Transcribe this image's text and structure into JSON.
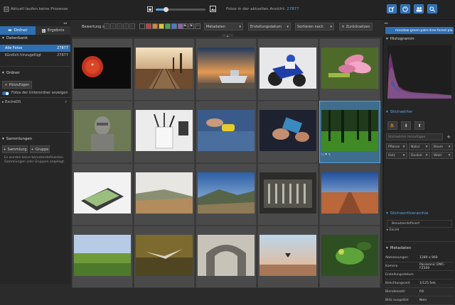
{
  "topbar": {
    "status": "Aktuell laufen keine Prozesse",
    "photos_label": "Fotos in der aktuellen Ansicht:",
    "photos_count": "27877",
    "zoom_fraction": 0.2
  },
  "filterbar": {
    "rating_label": "Bewertung",
    "rating_op": "≥",
    "metadata": "Metadaten",
    "date": "Erstellungsdatum",
    "sort": "Sortieren nach",
    "reset": "Zurücksetzen",
    "color_swatches": [
      "#c43c3c",
      "#d08a2e",
      "#d6c93a",
      "#4aa84a",
      "#3e7fd0",
      "#9a5ac8"
    ]
  },
  "sidebar": {
    "tab_folders": "Ordner",
    "tab_results": "Ergebnis",
    "db_title": "Datenbank",
    "db_items": [
      {
        "label": "Alle Fotos",
        "count": "27877"
      },
      {
        "label": "Kürzlich hinzugefügt",
        "count": "27877"
      }
    ],
    "folders_title": "Ordner",
    "add_button": "Hinzufügen",
    "subfolders_toggle": "Fotos der Unterordner anzeigen",
    "folder_item": "ExcireDS",
    "collections_title": "Sammlungen",
    "add_collection": "Sammlung",
    "add_group": "Gruppe",
    "empty_note": "Es wurden keine benutzerdefinierten Sammlungen oder Gruppen angelegt."
  },
  "right": {
    "filename": "meadow-green-palm-tree-forest-pla...",
    "histogram_title": "Histogramm",
    "keywords_title": "Stichwörter",
    "keyword_placeholder": "Stichwörter hinzufügen",
    "tags": [
      "Pflanze",
      "Natur",
      "Baum",
      "Holz",
      "Dunkel",
      "Wald"
    ],
    "hierarchy_title": "Stichworthierarchie",
    "hierarchy_items": [
      "Benutzerdefiniert",
      "Excire"
    ],
    "metadata_title": "Metadaten",
    "metadata_rows": [
      {
        "key": "Abmessungen",
        "value": "1280 x 960"
      },
      {
        "key": "Kamera",
        "value": "Panasonic DMC-FZ300"
      },
      {
        "key": "Erstellungsdatum",
        "value": ""
      },
      {
        "key": "Belichtungszeit",
        "value": "1/125 Sek."
      },
      {
        "key": "Blendenzahl",
        "value": "f/4"
      },
      {
        "key": "Blitz ausgelöst",
        "value": "Nein"
      }
    ]
  },
  "photos": [
    "red-sun",
    "railway-sunset",
    "boat-shore",
    "motorbike-race",
    "pink-flower",
    "stone-statue",
    "pencil-cup",
    "hands-cleaning-table",
    "hands-phone",
    "green-forest",
    "money-box",
    "hills-road",
    "mountain-valley",
    "mixing-console",
    "desert-road",
    "grass-field",
    "flying-bird",
    "stone-arch",
    "kite-surfer",
    "green-lizard"
  ],
  "colors": {
    "accent": "#5aa7e8",
    "selected": "#3f6d8e"
  }
}
